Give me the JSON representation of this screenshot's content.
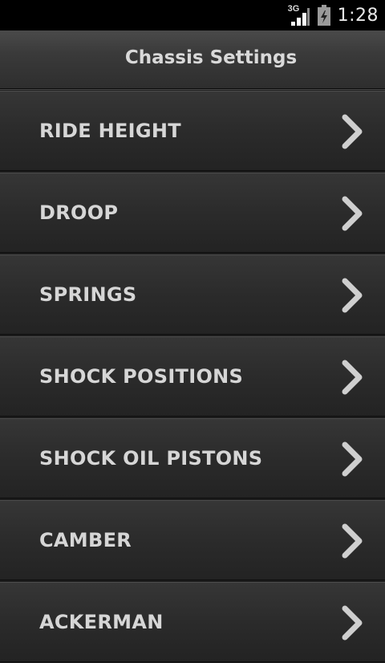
{
  "status_bar": {
    "network_type": "3G",
    "time": "1:28",
    "icons": [
      "signal-icon",
      "battery-icon"
    ]
  },
  "header": {
    "title": "Chassis Settings"
  },
  "menu": {
    "items": [
      {
        "label": "RIDE HEIGHT",
        "icon": "chevron-right-icon"
      },
      {
        "label": "DROOP",
        "icon": "chevron-right-icon"
      },
      {
        "label": "SPRINGS",
        "icon": "chevron-right-icon"
      },
      {
        "label": "SHOCK POSITIONS",
        "icon": "chevron-right-icon"
      },
      {
        "label": "SHOCK OIL PISTONS",
        "icon": "chevron-right-icon"
      },
      {
        "label": "CAMBER",
        "icon": "chevron-right-icon"
      },
      {
        "label": "ACKERMAN",
        "icon": "chevron-right-icon"
      }
    ]
  },
  "colors": {
    "status_bar_bg": "#000000",
    "header_bg": "#3a3a3a",
    "item_bg": "#2b2b2b",
    "text": "#d6d6d6",
    "chevron": "#cfcfcf"
  }
}
